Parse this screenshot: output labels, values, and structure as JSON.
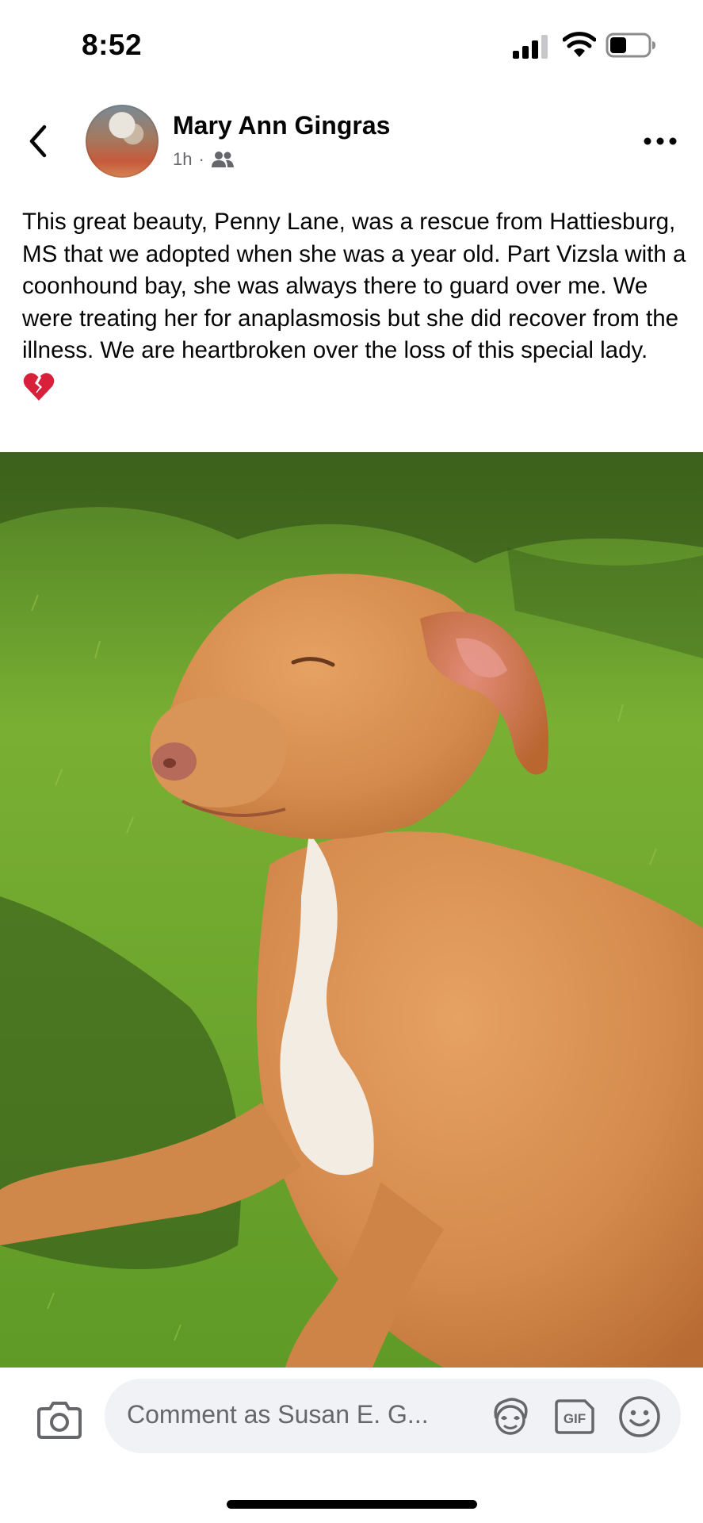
{
  "status_bar": {
    "time": "8:52",
    "icons": [
      "cellular-signal-icon",
      "wifi-icon",
      "battery-icon"
    ]
  },
  "post": {
    "author": "Mary Ann Gingras",
    "time_ago": "1h",
    "separator": "·",
    "audience_icon": "friends-icon",
    "caption": "This great beauty, Penny Lane, was a rescue from Hattiesburg, MS that we adopted when she was a year old. Part Vizsla with a coonhound bay, she was always there to guard over me. We were treating her for anaplasmosis but she did recover from the illness. We are heartbroken over the loss of this special lady.",
    "caption_emoji": "broken-heart-icon",
    "photo_subject": "dog-photo"
  },
  "comment_bar": {
    "placeholder": "Comment as Susan E. G...",
    "icons": [
      "camera-icon",
      "avatar-sticker-icon",
      "gif-icon",
      "emoji-icon"
    ],
    "gif_label": "GIF"
  },
  "colors": {
    "text_primary": "#050505",
    "text_secondary": "#65676b",
    "input_background": "#f0f2f5",
    "heart_red": "#d8203a",
    "grass_green": "#6fa52d",
    "dog_fur": "#d48a4c"
  }
}
